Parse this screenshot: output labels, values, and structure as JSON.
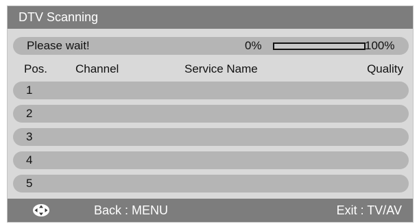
{
  "window": {
    "title": "DTV Scanning"
  },
  "status": {
    "message": "Please wait!",
    "progress_start_label": "0%",
    "progress_end_label": "100%",
    "progress_value": 0
  },
  "columns": {
    "pos": "Pos.",
    "channel": "Channel",
    "service_name": "Service Name",
    "quality": "Quality"
  },
  "rows": [
    {
      "pos": "1"
    },
    {
      "pos": "2"
    },
    {
      "pos": "3"
    },
    {
      "pos": "4"
    },
    {
      "pos": "5"
    }
  ],
  "footer": {
    "nav_icon": "navigation-cross-icon",
    "back_label": "Back : MENU",
    "exit_label": "Exit : TV/AV"
  },
  "colors": {
    "titlebar": "#7d7d7d",
    "panel": "#d9d9d9",
    "row": "#b5b5b5",
    "footer": "#7d7d7d"
  }
}
